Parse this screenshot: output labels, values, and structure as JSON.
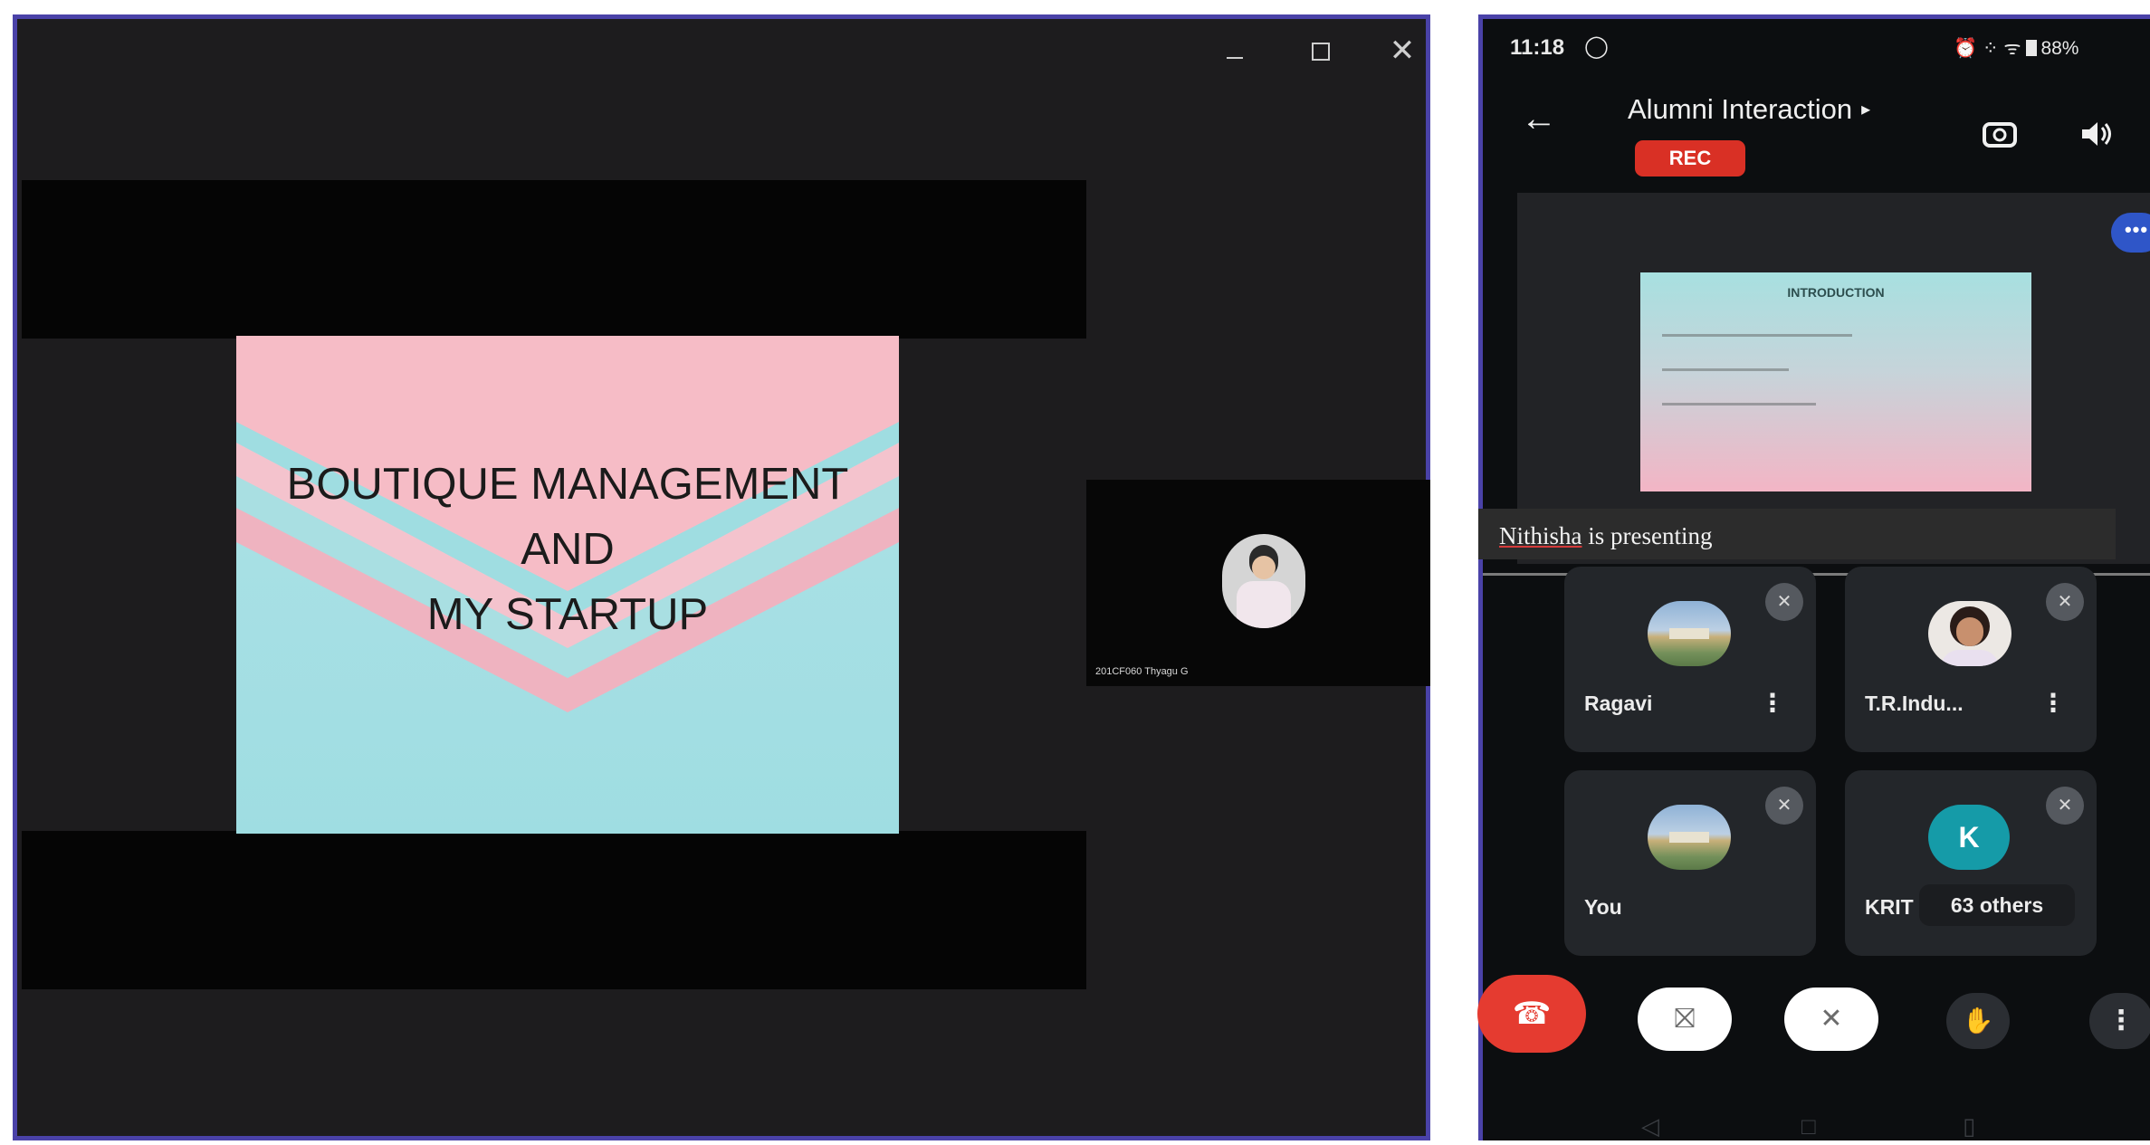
{
  "desktop": {
    "window_controls": {
      "minimize": "—",
      "maximize": "",
      "close": "✕"
    },
    "slide": {
      "title_lines": [
        "BOUTIQUE MANAGEMENT",
        "AND",
        "MY STARTUP"
      ]
    },
    "participant_tile": {
      "label": "201CF060 Thyagu G"
    }
  },
  "phone": {
    "status_bar": {
      "time": "11:18",
      "right_icons": "⏰ ⁘ ᯤ",
      "battery": "88%"
    },
    "header": {
      "back_icon": "←",
      "title": "Alumni Interaction",
      "title_caret": "▸",
      "rec_label": "REC"
    },
    "stage": {
      "more_label": "•••",
      "mini_slide_title": "INTRODUCTION",
      "presenting_name": "Nithisha",
      "presenting_suffix": " is presenting"
    },
    "participants": [
      {
        "name": "Ragavi"
      },
      {
        "name": "T.R.Indu..."
      },
      {
        "name": "You"
      },
      {
        "name": "KRIT",
        "avatar_letter": "K",
        "others": "63 others"
      }
    ],
    "controls": {
      "end_call_icon": "☎",
      "camera_icon": "⛝",
      "mic_icon": "✕",
      "hand_icon": "✋",
      "more_icon": "⋮"
    },
    "nav": {
      "back": "◁",
      "home": "□",
      "recents": "▯"
    },
    "colors": {
      "rec": "#d93025",
      "end_call": "#e53b30",
      "more_dots": "#2f56c8",
      "avatar_k": "#159ba8"
    }
  }
}
